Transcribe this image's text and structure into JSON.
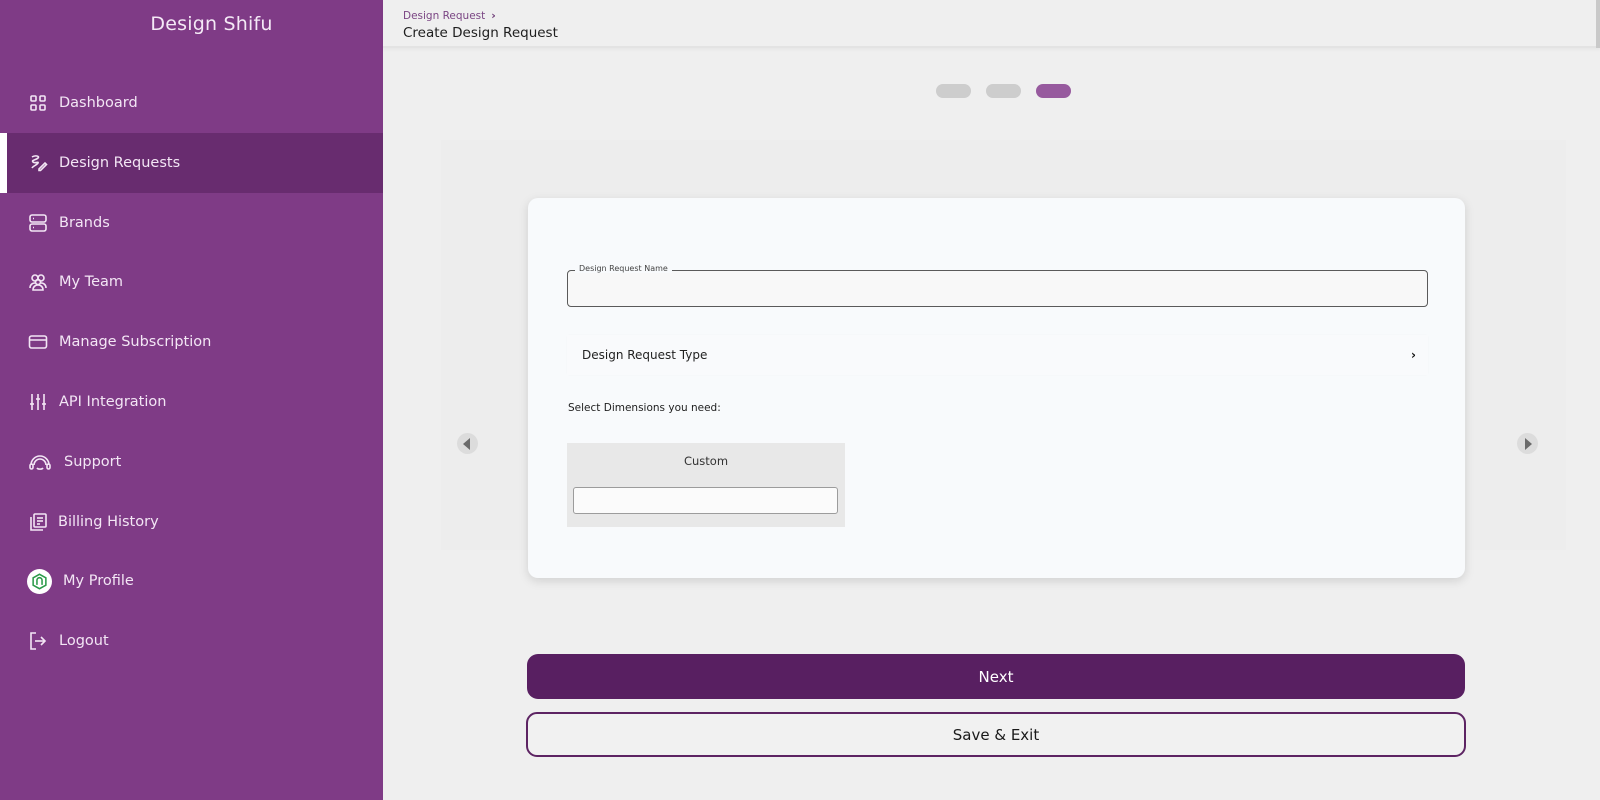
{
  "app": {
    "brand": "Design Shifu"
  },
  "sidebar": {
    "items": [
      {
        "label": "Dashboard",
        "icon": "grid-icon",
        "active": false
      },
      {
        "label": "Design Requests",
        "icon": "pen-squiggle-icon",
        "active": true
      },
      {
        "label": "Brands",
        "icon": "server-stack-icon",
        "active": false
      },
      {
        "label": "My Team",
        "icon": "team-icon",
        "active": false
      },
      {
        "label": "Manage Subscription",
        "icon": "credit-card-icon",
        "active": false
      },
      {
        "label": "API Integration",
        "icon": "sliders-icon",
        "active": false
      },
      {
        "label": "Support",
        "icon": "headset-icon",
        "active": false
      },
      {
        "label": "Billing History",
        "icon": "receipt-icon",
        "active": false
      },
      {
        "label": "My Profile",
        "icon": "avatar-icon",
        "active": false
      },
      {
        "label": "Logout",
        "icon": "logout-icon",
        "active": false
      }
    ]
  },
  "header": {
    "breadcrumb": "Design Request",
    "title": "Create Design Request"
  },
  "stepper": {
    "total": 3,
    "current": 3
  },
  "form": {
    "name_label": "Design Request Name",
    "name_value": "",
    "type_label": "Design Request Type",
    "dimensions_label": "Select Dimensions you need:",
    "custom_title": "Custom",
    "custom_value": ""
  },
  "actions": {
    "next": "Next",
    "save_exit": "Save & Exit"
  },
  "colors": {
    "sidebar": "#7f3b86",
    "sidebar_active": "#682c6f",
    "primary_button": "#581f61",
    "step_active": "#975a9e"
  }
}
